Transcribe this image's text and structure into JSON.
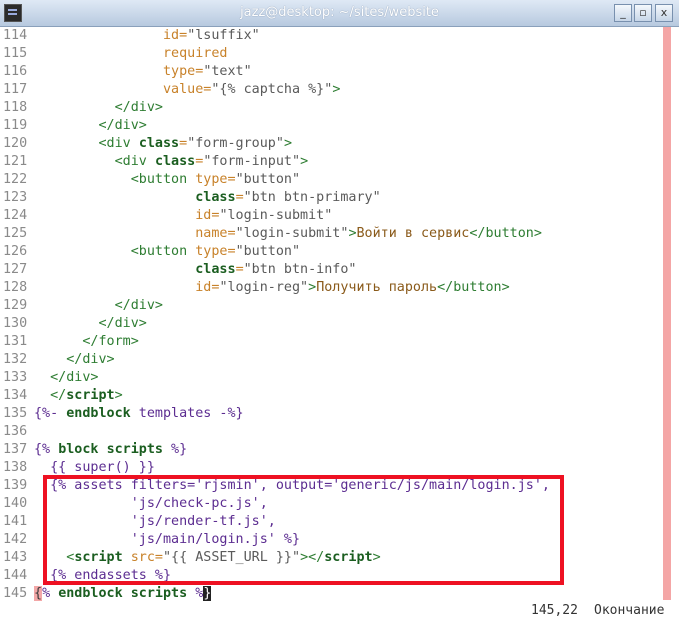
{
  "window": {
    "title": "jazz@desktop: ~/sites/website",
    "buttons": {
      "minimize": "_",
      "maximize": "▫",
      "close": "x"
    }
  },
  "editor": {
    "lines": [
      {
        "n": "114",
        "segs": [
          [
            "",
            "                "
          ],
          [
            "attr",
            "id="
          ],
          [
            "str",
            "\"lsuffix\""
          ]
        ]
      },
      {
        "n": "115",
        "segs": [
          [
            "",
            "                "
          ],
          [
            "attr",
            "required"
          ]
        ]
      },
      {
        "n": "116",
        "segs": [
          [
            "",
            "                "
          ],
          [
            "attr",
            "type="
          ],
          [
            "str",
            "\"text\""
          ]
        ]
      },
      {
        "n": "117",
        "segs": [
          [
            "",
            "                "
          ],
          [
            "attr",
            "value="
          ],
          [
            "str",
            "\"{% captcha %}\""
          ],
          [
            "tag",
            ">"
          ]
        ]
      },
      {
        "n": "118",
        "segs": [
          [
            "",
            "          "
          ],
          [
            "tag",
            "</div>"
          ]
        ]
      },
      {
        "n": "119",
        "segs": [
          [
            "",
            "        "
          ],
          [
            "tag",
            "</div>"
          ]
        ]
      },
      {
        "n": "120",
        "segs": [
          [
            "",
            "        "
          ],
          [
            "tag",
            "<div "
          ],
          [
            "kw",
            "class"
          ],
          [
            "attr",
            "="
          ],
          [
            "str",
            "\"form-group\""
          ],
          [
            "tag",
            ">"
          ]
        ]
      },
      {
        "n": "121",
        "segs": [
          [
            "",
            "          "
          ],
          [
            "tag",
            "<div "
          ],
          [
            "kw",
            "class"
          ],
          [
            "attr",
            "="
          ],
          [
            "str",
            "\"form-input\""
          ],
          [
            "tag",
            ">"
          ]
        ]
      },
      {
        "n": "122",
        "segs": [
          [
            "",
            "            "
          ],
          [
            "tag",
            "<button "
          ],
          [
            "attr",
            "type="
          ],
          [
            "str",
            "\"button\""
          ]
        ]
      },
      {
        "n": "123",
        "segs": [
          [
            "",
            "                    "
          ],
          [
            "kw",
            "class"
          ],
          [
            "attr",
            "="
          ],
          [
            "str",
            "\"btn btn-primary\""
          ]
        ]
      },
      {
        "n": "124",
        "segs": [
          [
            "",
            "                    "
          ],
          [
            "attr",
            "id="
          ],
          [
            "str",
            "\"login-submit\""
          ]
        ]
      },
      {
        "n": "125",
        "segs": [
          [
            "",
            "                    "
          ],
          [
            "attr",
            "name="
          ],
          [
            "str",
            "\"login-submit\""
          ],
          [
            "tag",
            ">"
          ],
          [
            "txt",
            "Войти в сервис"
          ],
          [
            "tag",
            "</button>"
          ]
        ]
      },
      {
        "n": "126",
        "segs": [
          [
            "",
            "            "
          ],
          [
            "tag",
            "<button "
          ],
          [
            "attr",
            "type="
          ],
          [
            "str",
            "\"button\""
          ]
        ]
      },
      {
        "n": "127",
        "segs": [
          [
            "",
            "                    "
          ],
          [
            "kw",
            "class"
          ],
          [
            "attr",
            "="
          ],
          [
            "str",
            "\"btn btn-info\""
          ]
        ]
      },
      {
        "n": "128",
        "segs": [
          [
            "",
            "                    "
          ],
          [
            "attr",
            "id="
          ],
          [
            "str",
            "\"login-reg\""
          ],
          [
            "tag",
            ">"
          ],
          [
            "txt",
            "Получить пароль"
          ],
          [
            "tag",
            "</button>"
          ]
        ]
      },
      {
        "n": "129",
        "segs": [
          [
            "",
            "          "
          ],
          [
            "tag",
            "</div>"
          ]
        ]
      },
      {
        "n": "130",
        "segs": [
          [
            "",
            "        "
          ],
          [
            "tag",
            "</div>"
          ]
        ]
      },
      {
        "n": "131",
        "segs": [
          [
            "",
            "      "
          ],
          [
            "tag",
            "</form>"
          ]
        ]
      },
      {
        "n": "132",
        "segs": [
          [
            "",
            "    "
          ],
          [
            "tag",
            "</div>"
          ]
        ]
      },
      {
        "n": "133",
        "segs": [
          [
            "",
            "  "
          ],
          [
            "tag",
            "</div>"
          ]
        ]
      },
      {
        "n": "134",
        "segs": [
          [
            "",
            "  "
          ],
          [
            "tag",
            "</"
          ],
          [
            "kw",
            "script"
          ],
          [
            "tag",
            ">"
          ]
        ]
      },
      {
        "n": "135",
        "segs": [
          [
            "tpl",
            "{%- "
          ],
          [
            "kw",
            "endblock"
          ],
          [
            "tpl",
            " templates -%}"
          ]
        ]
      },
      {
        "n": "136",
        "segs": []
      },
      {
        "n": "137",
        "segs": [
          [
            "tpl",
            "{% "
          ],
          [
            "kw",
            "block"
          ],
          [
            "tpl",
            " "
          ],
          [
            "kw",
            "scripts"
          ],
          [
            "tpl",
            " %}"
          ]
        ]
      },
      {
        "n": "138",
        "segs": [
          [
            "",
            "  "
          ],
          [
            "tpl",
            "{{ super() }}"
          ]
        ]
      },
      {
        "n": "139",
        "segs": [
          [
            "",
            "  "
          ],
          [
            "tpl",
            "{% assets filters='rjsmin', output='generic/js/main/login.js',"
          ]
        ]
      },
      {
        "n": "140",
        "segs": [
          [
            "",
            "            "
          ],
          [
            "tpl",
            "'js/check-pc.js',"
          ]
        ]
      },
      {
        "n": "141",
        "segs": [
          [
            "",
            "            "
          ],
          [
            "tpl",
            "'js/render-tf.js',"
          ]
        ]
      },
      {
        "n": "142",
        "segs": [
          [
            "",
            "            "
          ],
          [
            "tpl",
            "'js/main/login.js' %}"
          ]
        ]
      },
      {
        "n": "143",
        "segs": [
          [
            "",
            "    "
          ],
          [
            "tag",
            "<"
          ],
          [
            "kw",
            "script"
          ],
          [
            "tag",
            " "
          ],
          [
            "attr",
            "src="
          ],
          [
            "str",
            "\"{{ ASSET_URL }}\""
          ],
          [
            "tag",
            "></"
          ],
          [
            "kw",
            "script"
          ],
          [
            "tag",
            ">"
          ]
        ]
      },
      {
        "n": "144",
        "segs": [
          [
            "",
            "  "
          ],
          [
            "tpl",
            "{% endassets %}"
          ]
        ]
      },
      {
        "n": "145",
        "segs": [
          [
            "cursor-pre",
            "{"
          ],
          [
            "tpl",
            "% "
          ],
          [
            "kw",
            "endblock"
          ],
          [
            "tpl",
            " "
          ],
          [
            "kw",
            "scripts"
          ],
          [
            "tpl",
            " %"
          ],
          [
            "cursor-post",
            "}"
          ]
        ]
      }
    ]
  },
  "status": {
    "position": "145,22",
    "mode": "Окончание"
  },
  "colors": {
    "selection_border": "#ee1122",
    "column_marker": "#f4a6a6",
    "tag": "#2e7d32",
    "attr": "#c8822a"
  }
}
